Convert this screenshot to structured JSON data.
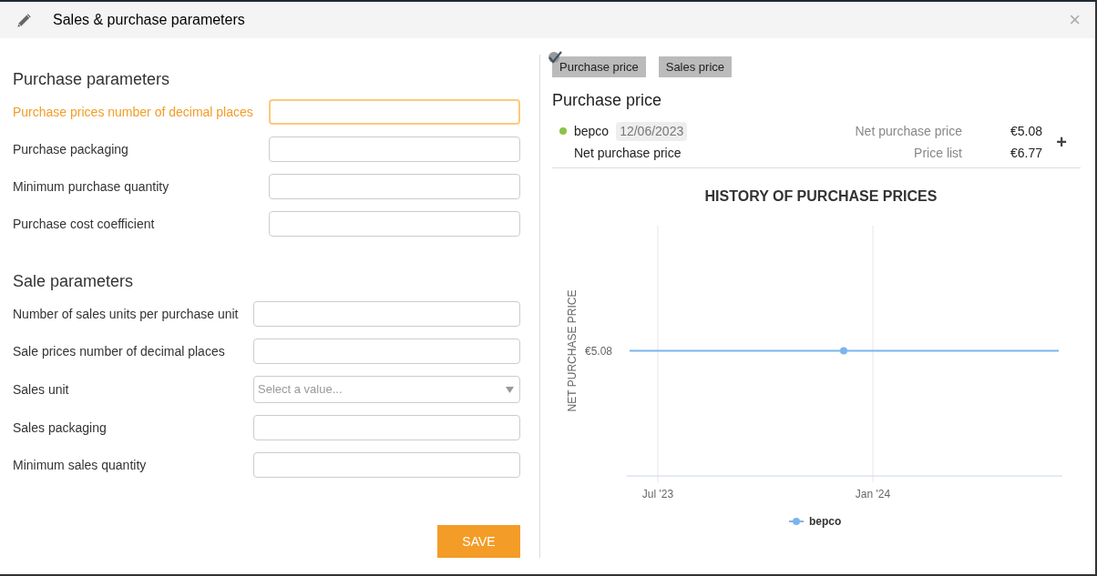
{
  "window": {
    "title": "Sales & purchase parameters",
    "close": "×"
  },
  "sections": [
    {
      "title": "Purchase parameters",
      "fields": [
        {
          "label": "Purchase prices number of decimal places",
          "kind": "text",
          "focused": true
        },
        {
          "label": "Purchase packaging",
          "kind": "text",
          "focused": false
        },
        {
          "label": "Minimum purchase quantity",
          "kind": "text",
          "focused": false
        },
        {
          "label": "Purchase cost coefficient",
          "kind": "text",
          "focused": false
        }
      ]
    },
    {
      "title": "Sale parameters",
      "fields": [
        {
          "label": "Number of sales units per purchase unit",
          "kind": "text",
          "focused": false
        },
        {
          "label": "Sale prices number of decimal places",
          "kind": "text",
          "focused": false
        },
        {
          "label": "Sales unit",
          "kind": "select",
          "placeholder": "Select a value..."
        },
        {
          "label": "Sales packaging",
          "kind": "text",
          "focused": false
        },
        {
          "label": "Minimum sales quantity",
          "kind": "text",
          "focused": false
        }
      ]
    }
  ],
  "save_button": "SAVE",
  "tabs": [
    {
      "label": "Purchase price",
      "selected": true
    },
    {
      "label": "Sales price",
      "selected": false
    }
  ],
  "price_heading": "Purchase price",
  "supplier": {
    "name": "bepco",
    "color": "#8bc34a",
    "date": "12/06/2023",
    "type": "Net purchase price",
    "prices": [
      {
        "label": "Net purchase price",
        "value": "€5.08"
      },
      {
        "label": "Price list",
        "value": "€6.77"
      }
    ],
    "add": "+"
  },
  "chart": {
    "title": "HISTORY OF PURCHASE PRICES",
    "y_axis_title": "NET PURCHASE PRICE",
    "y_label": "€5.08",
    "x_labels": [
      "Jul '23",
      "Jan '24"
    ],
    "legend": [
      "bepco"
    ]
  }
}
